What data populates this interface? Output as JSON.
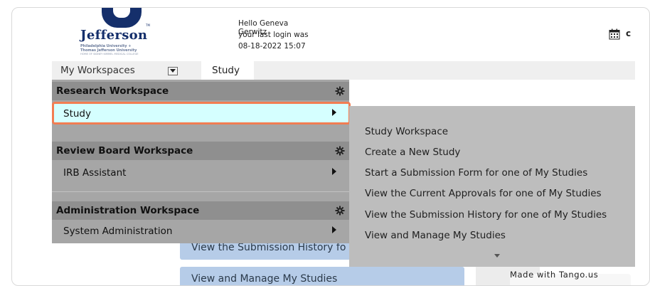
{
  "logo": {
    "wordmark": "Jefferson",
    "tm": "TM",
    "line1": "Philadelphia University +",
    "line2": "Thomas Jefferson University",
    "line3": "HOME OF SIDNEY KIMMEL MEDICAL COLLEGE"
  },
  "greeting": {
    "line1": "Hello Geneva Gerwitz",
    "line2": "your last login was",
    "line3": "08-18-2022 15:07"
  },
  "header": {
    "calendar_icon": "calendar-icon",
    "truncated_label": "c"
  },
  "nav": {
    "workspaces_label": "My Workspaces",
    "study_tab": "Study"
  },
  "menu": {
    "sections": [
      {
        "title": "Research Workspace",
        "items": [
          {
            "label": "Study"
          }
        ]
      },
      {
        "title": "Review Board Workspace",
        "items": [
          {
            "label": "IRB Assistant"
          }
        ]
      },
      {
        "title": "Administration Workspace",
        "items": [
          {
            "label": "System Administration"
          }
        ]
      }
    ]
  },
  "submenu": {
    "items": [
      "Study Workspace",
      "Create a New Study",
      "Start a Submission Form for one of My Studies",
      "View the Current Approvals for one of My Studies",
      "View the Submission History for one of My Studies",
      "View and Manage My Studies"
    ]
  },
  "background_buttons": [
    "View the Submission History fo",
    "View and Manage My Studies"
  ],
  "watermark": "Made with Tango.us",
  "colors": {
    "highlight_border": "#f27d52",
    "highlight_fill": "#d5ffff",
    "menu_bg": "#a6a6a6",
    "submenu_bg": "#bdbdbd",
    "section_head": "#8f8f8f",
    "brand_navy": "#152f6b"
  }
}
